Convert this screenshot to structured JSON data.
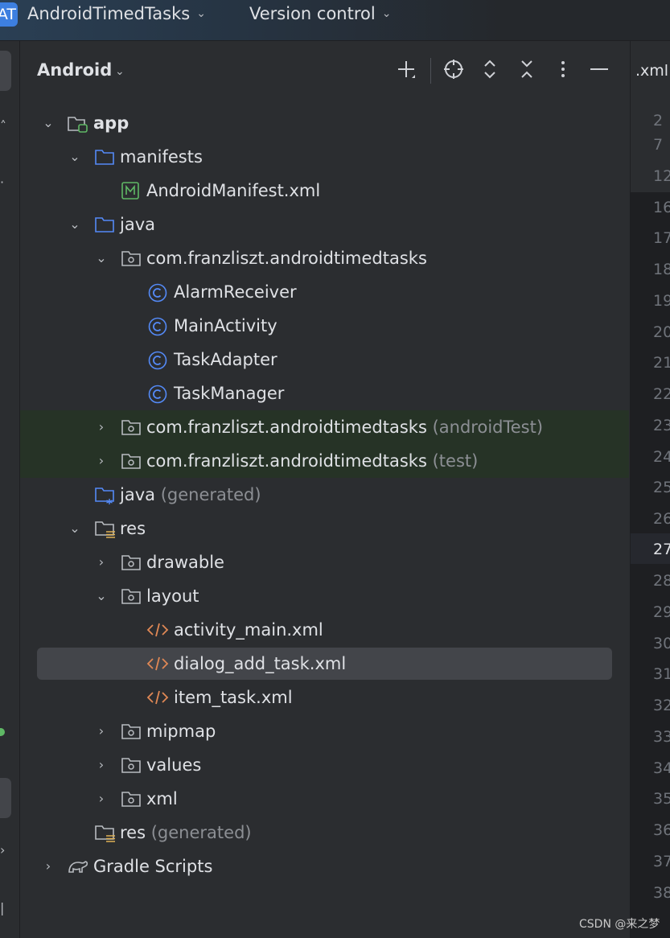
{
  "titlebar": {
    "project_badge": "AT",
    "project_name": "AndroidTimedTasks",
    "vcs_label": "Version control"
  },
  "panel": {
    "view_title": "Android",
    "header_icons": [
      "add-icon",
      "locate-icon",
      "expand-all-icon",
      "collapse-all-icon",
      "more-icon",
      "minimize-icon"
    ]
  },
  "tree": {
    "app": "app",
    "manifests": "manifests",
    "android_manifest": "AndroidManifest.xml",
    "java": "java",
    "pkg_main": "com.franzliszt.androidtimedtasks",
    "alarm_receiver": "AlarmReceiver",
    "main_activity": "MainActivity",
    "task_adapter": "TaskAdapter",
    "task_manager": "TaskManager",
    "pkg_android_test": "com.franzliszt.androidtimedtasks",
    "pkg_android_test_suffix": "(androidTest)",
    "pkg_test": "com.franzliszt.androidtimedtasks",
    "pkg_test_suffix": "(test)",
    "java_generated": "java",
    "java_generated_suffix": "(generated)",
    "res": "res",
    "drawable": "drawable",
    "layout": "layout",
    "activity_main": "activity_main.xml",
    "dialog_add_task": "dialog_add_task.xml",
    "item_task": "item_task.xml",
    "mipmap": "mipmap",
    "values": "values",
    "xml": "xml",
    "res_generated": "res",
    "res_generated_suffix": "(generated)",
    "gradle_scripts": "Gradle Scripts"
  },
  "editor": {
    "tab_label": ".xml",
    "line_numbers": [
      "2",
      "7",
      "12",
      "16",
      "17",
      "18",
      "19",
      "20",
      "21",
      "22",
      "23",
      "24",
      "25",
      "26",
      "27",
      "28",
      "29",
      "30",
      "31",
      "32",
      "33",
      "34",
      "35",
      "36",
      "37",
      "38"
    ],
    "current_line": "27"
  },
  "watermark": "CSDN @来之梦",
  "colors": {
    "background": "#2b2d30",
    "folder": "#548af7",
    "class_icon": "#548af7",
    "xml_icon": "#e08855",
    "manifest_icon": "#5fb865",
    "test_row_bg": "#263326",
    "selected_row_bg": "#43454a"
  }
}
